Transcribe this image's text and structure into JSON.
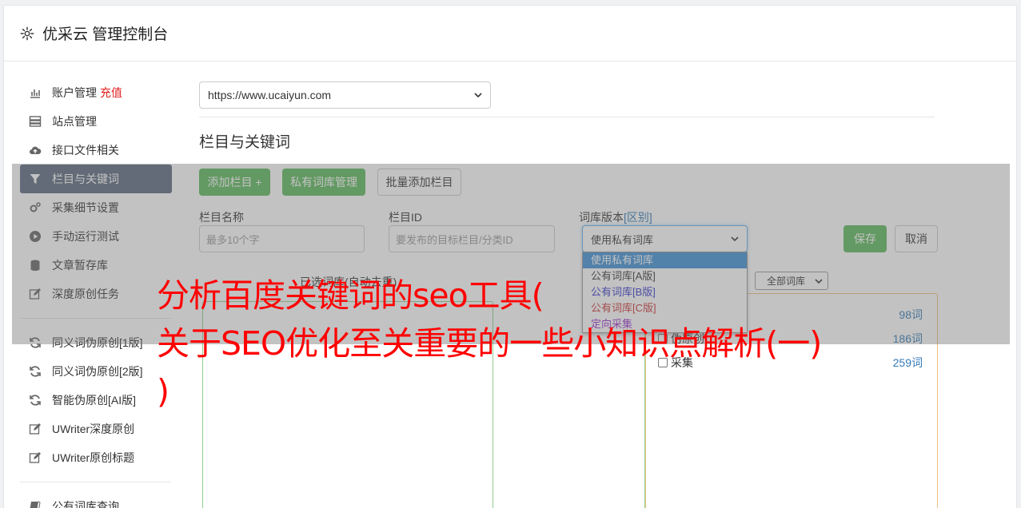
{
  "app": {
    "title": "优采云 管理控制台"
  },
  "sidebar": {
    "items": [
      {
        "label": "账户管理",
        "badge": "充值",
        "icon": "bar-chart-icon"
      },
      {
        "label": "站点管理",
        "icon": "server-icon"
      },
      {
        "label": "接口文件相关",
        "icon": "cloud-upload-icon"
      },
      {
        "label": "栏目与关键词",
        "icon": "filter-icon",
        "active": true
      },
      {
        "label": "采集细节设置",
        "icon": "cogs-icon"
      },
      {
        "label": "手动运行测试",
        "icon": "play-circle-icon"
      },
      {
        "label": "文章暂存库",
        "icon": "database-icon"
      },
      {
        "label": "深度原创任务",
        "icon": "edit-icon"
      },
      {
        "label": "同义词伪原创[1版]",
        "icon": "refresh-icon"
      },
      {
        "label": "同义词伪原创[2版]",
        "icon": "refresh-icon"
      },
      {
        "label": "智能伪原创[AI版]",
        "icon": "refresh-icon"
      },
      {
        "label": "UWriter深度原创",
        "icon": "edit-icon"
      },
      {
        "label": "UWriter原创标题",
        "icon": "edit-icon"
      },
      {
        "label": "公有词库查询",
        "icon": "book-icon"
      }
    ]
  },
  "main": {
    "site_select": {
      "value": "https://www.ucaiyun.com"
    },
    "section_title": "栏目与关键词",
    "buttons": {
      "add_column": "添加栏目 +",
      "private_lib": "私有词库管理",
      "batch_add": "批量添加栏目",
      "save": "保存",
      "cancel": "取消"
    },
    "form": {
      "column_name_label": "栏目名称",
      "column_name_placeholder": "最多10个字",
      "column_id_label": "栏目ID",
      "column_id_placeholder": "要发布的目标栏目/分类ID",
      "lib_version_label": "词库版本",
      "lib_version_diff": "[区别]",
      "lib_version_value": "使用私有词库"
    },
    "dropdown_options": [
      {
        "label": "使用私有词库",
        "color": "#ffffff",
        "selected": true
      },
      {
        "label": "公有词库[A版]",
        "color": "#333333"
      },
      {
        "label": "公有词库[B版]",
        "color": "#3333cc"
      },
      {
        "label": "公有词库[C版]",
        "color": "#cc3333"
      },
      {
        "label": "定向采集",
        "color": "#9933cc"
      }
    ],
    "selected_words_label": "已选词库(自动去重)",
    "filter_select": "全部词库",
    "library_rows": [
      {
        "label": "",
        "count": "98词"
      },
      {
        "label": "伪原创",
        "count": "186词"
      },
      {
        "label": "采集",
        "count": "259词"
      }
    ]
  },
  "article_title": {
    "line1": "分析百度关键词的seo工具(",
    "line2": "关于SEO优化至关重要的一些小知识点解析(一)",
    "line3": ")"
  }
}
